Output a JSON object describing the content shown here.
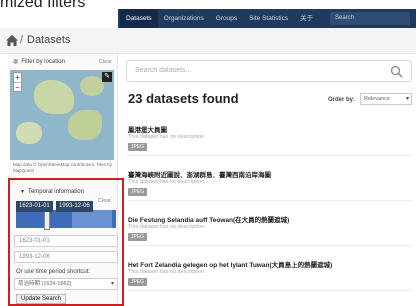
{
  "slide_caption": "mized filters",
  "topnav": {
    "items": [
      "Datasets",
      "Organizations",
      "Groups",
      "Site Statistics",
      "关于"
    ],
    "search_placeholder": "Search"
  },
  "breadcrumb": {
    "title": "Datasets",
    "separator": "/"
  },
  "sidebar": {
    "location_filter": {
      "heading": "Filter by location",
      "clear": "Clear",
      "credit": "Map data © OpenStreetMap contributors, Tiles by MapQuest"
    },
    "time_filter": {
      "heading": "Temporal information",
      "clear": "Clear",
      "start_chip": "1623-01-01",
      "end_chip": "1993-12-06",
      "start_field": "1623-01-01",
      "end_field": "1993-12-06",
      "shortcut_label": "Or use time period shortcut:",
      "shortcut_value": "荷治時期 (1624-1662)",
      "update_button": "Update Search"
    }
  },
  "main": {
    "search_placeholder": "Search datasets...",
    "found_text": "23 datasets found",
    "order_label": "Order by:",
    "order_value": "Relevance"
  },
  "results": [
    {
      "title": "鳳港堡大員圖",
      "desc": "This dataset has no description",
      "badge": "JPEG"
    },
    {
      "title": "臺灣海峽附近圖說．澎湖群島．臺灣西南沿岸海圖",
      "desc": "This dataset has no description",
      "badge": "JPEG"
    },
    {
      "title": "Die Festung Selandia auff Teowan(在大員的熱蘭遮城)",
      "desc": "This dataset has no description",
      "badge": "JPEG"
    },
    {
      "title": "Het Fort Zelandia gelegen op het lylant Tuwan(大員島上的熱蘭遮城)",
      "desc": "This dataset has no description",
      "badge": "JPEG"
    }
  ]
}
